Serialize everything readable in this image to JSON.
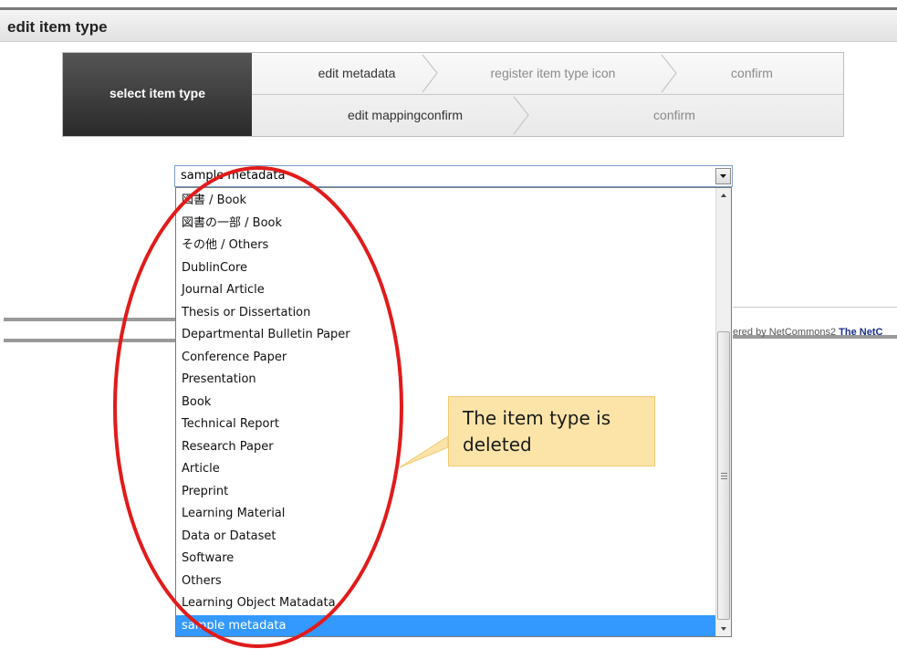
{
  "header": {
    "title": "edit item type"
  },
  "wizard": {
    "active_step": "select item type",
    "row1": [
      "edit metadata",
      "register item type icon",
      "confirm"
    ],
    "row2": [
      "edit mappingconfirm",
      "confirm"
    ]
  },
  "select": {
    "value": "sample metadata",
    "options": [
      "図書 / Book",
      "図書の一部 / Book",
      "その他 / Others",
      "DublinCore",
      "Journal Article",
      "Thesis or Dissertation",
      "Departmental Bulletin Paper",
      "Conference Paper",
      "Presentation",
      "Book",
      "Technical Report",
      "Research Paper",
      "Article",
      "Preprint",
      "Learning Material",
      "Data or Dataset",
      "Software",
      "Others",
      "Learning Object Matadata",
      "sample metadata"
    ],
    "selected_index": 19
  },
  "footer": {
    "powered_text": "ered by NetCommons2",
    "powered_brand": "The NetC"
  },
  "callout": {
    "text": "The item type is deleted"
  },
  "colors": {
    "selection": "#3399ff",
    "annotation": "#e11b1b",
    "callout_fill": "#fce4a8"
  }
}
